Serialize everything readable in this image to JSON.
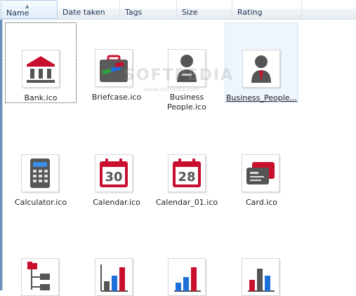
{
  "columns": [
    {
      "label": "Name"
    },
    {
      "label": "Date taken"
    },
    {
      "label": "Tags"
    },
    {
      "label": "Size"
    },
    {
      "label": "Rating"
    }
  ],
  "items": [
    {
      "label": "Bank.ico"
    },
    {
      "label": "Briefcase.ico"
    },
    {
      "label": "Business\nPeople.ico"
    },
    {
      "label": "Business_People..."
    },
    {
      "label": "Calculator.ico"
    },
    {
      "label": "Calendar.ico"
    },
    {
      "label": "Calendar_01.ico"
    },
    {
      "label": "Card.ico"
    }
  ],
  "calendar_numbers": [
    "30",
    "28"
  ],
  "watermark": {
    "main": "SOFTPEDIA",
    "sub": "www.softpedia.com"
  },
  "colors": {
    "red": "#c8102e",
    "gray": "#585858",
    "blue": "#1e6fd9",
    "green": "#2ea043",
    "selection": "#eef5fd"
  },
  "icons": [
    "bank-icon",
    "briefcase-icon",
    "business-people-icon",
    "businessman-icon",
    "calculator-icon",
    "calendar-icon",
    "calendar-icon",
    "card-icon",
    "folder-tree-icon",
    "bar-chart-icon",
    "bar-chart-icon",
    "bar-chart-icon"
  ]
}
